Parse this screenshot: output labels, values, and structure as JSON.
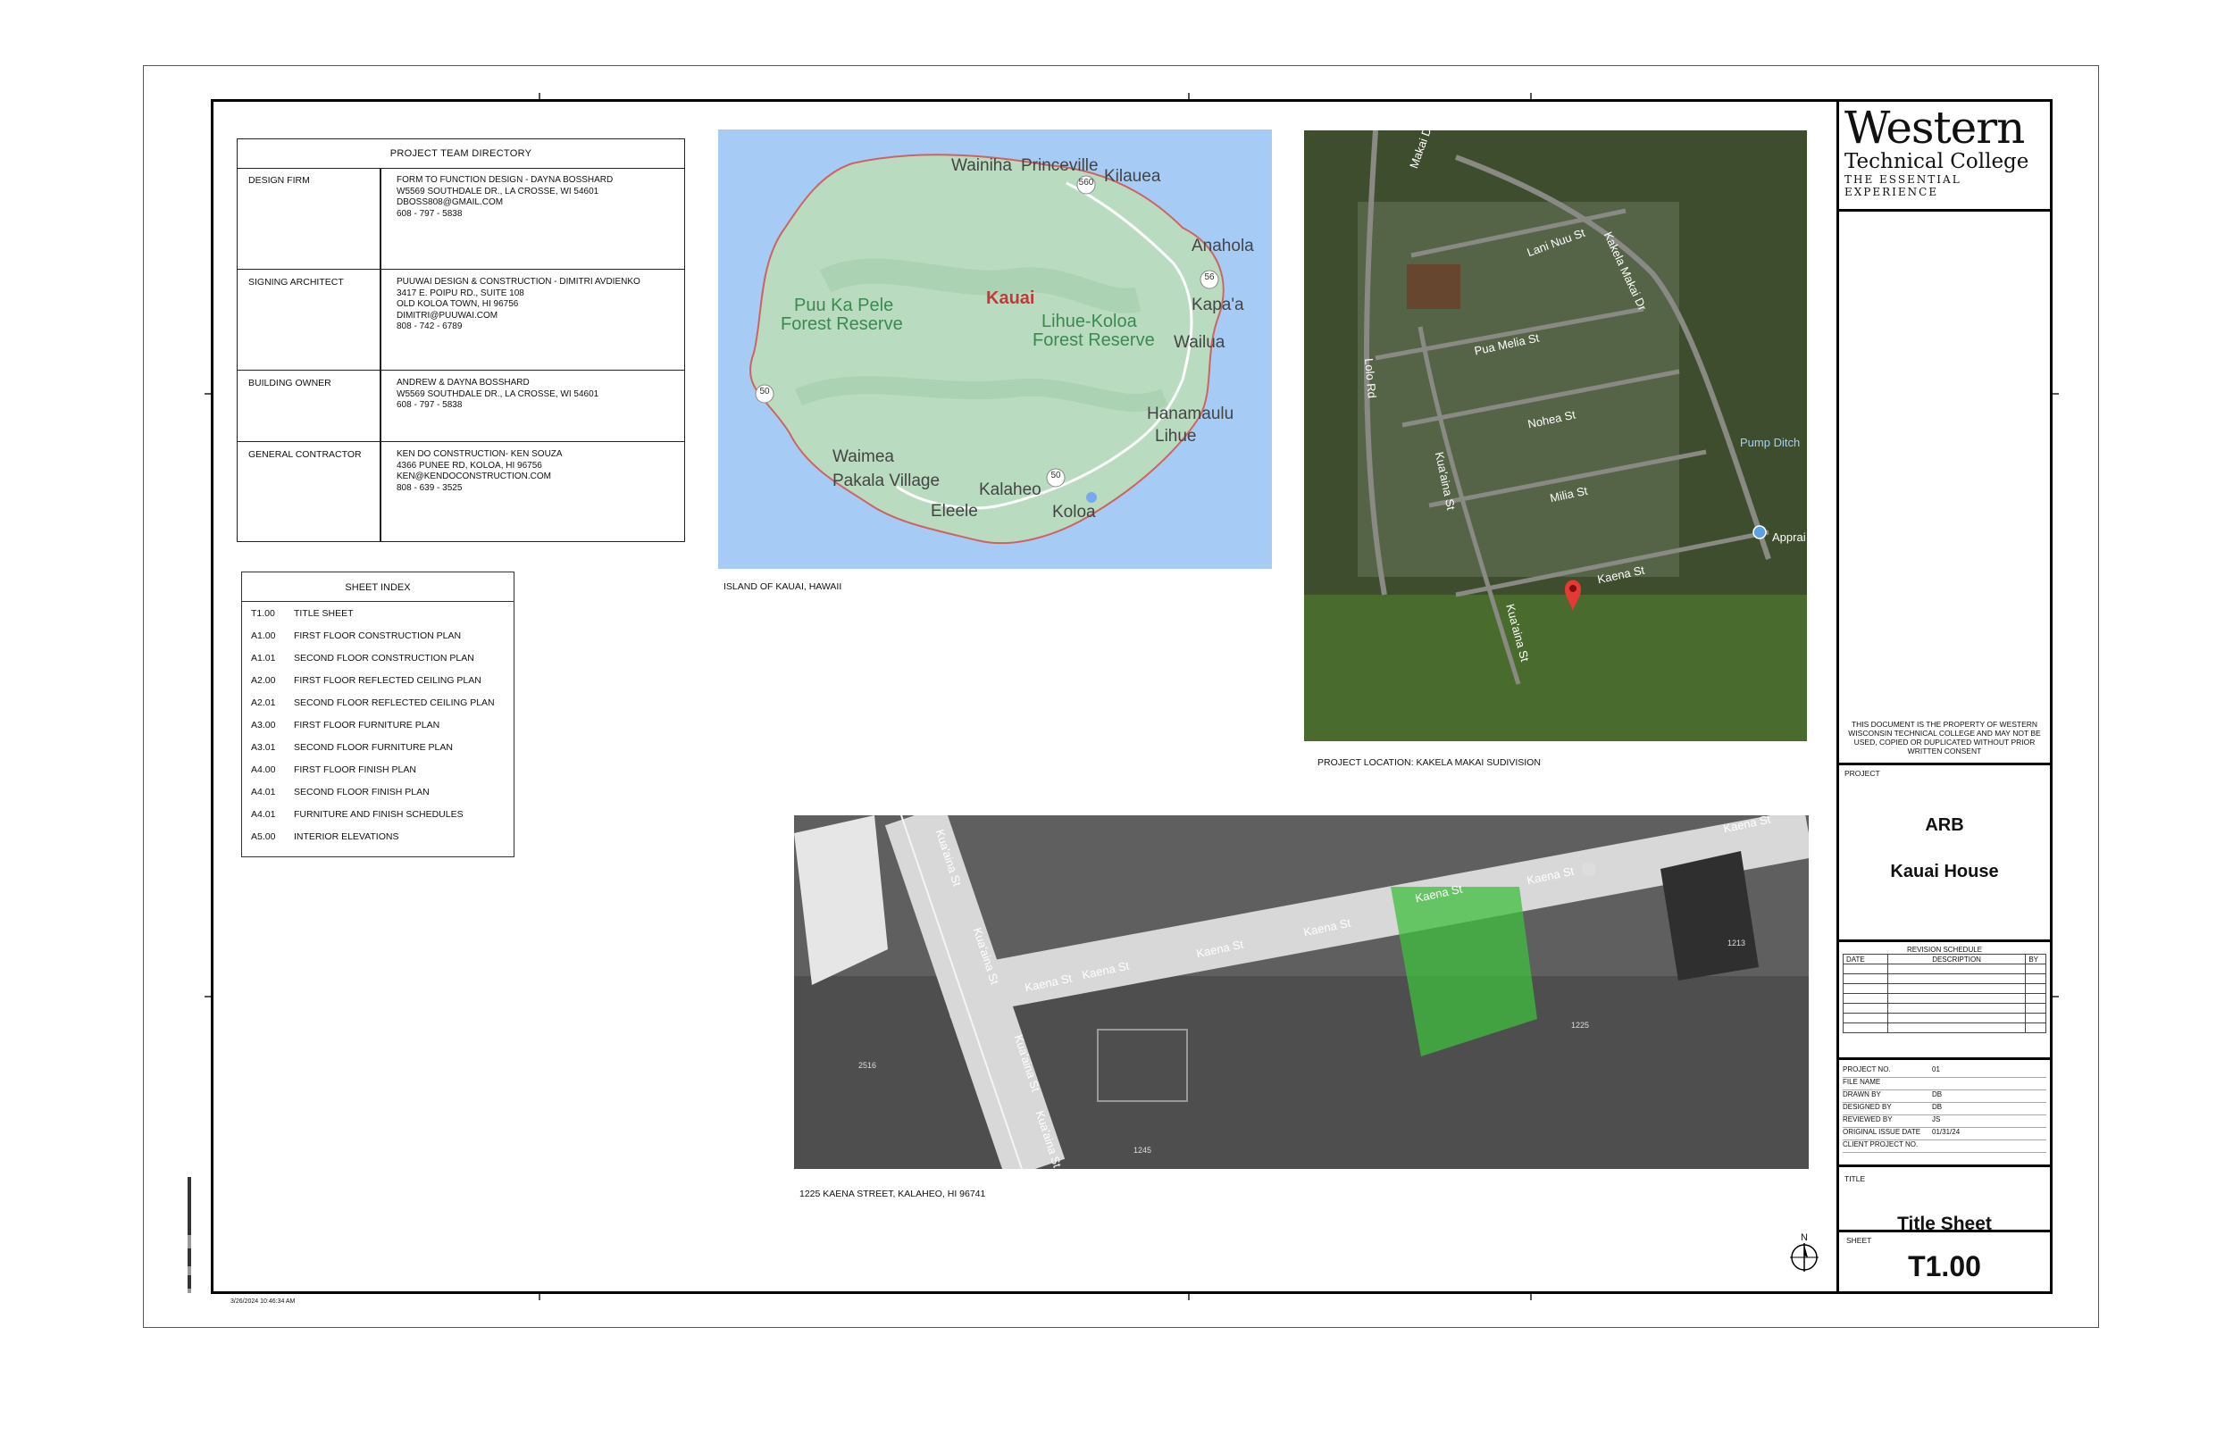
{
  "directory": {
    "title": "PROJECT TEAM DIRECTORY",
    "rows": [
      {
        "label": "DESIGN FIRM",
        "lines": [
          "FORM TO FUNCTION DESIGN - DAYNA BOSSHARD",
          "W5569 SOUTHDALE DR., LA CROSSE, WI 54601",
          "DBOSS808@GMAIL.COM",
          "608 - 797 - 5838"
        ]
      },
      {
        "label": "SIGNING ARCHITECT",
        "lines": [
          "PUUWAI DESIGN & CONSTRUCTION - DIMITRI AVDIENKO",
          "3417 E. POIPU RD., SUITE 108",
          "OLD KOLOA TOWN, HI 96756",
          "DIMITRI@PUUWAI.COM",
          "808 - 742 - 6789"
        ]
      },
      {
        "label": "BUILDING OWNER",
        "lines": [
          "ANDREW & DAYNA BOSSHARD",
          "W5569 SOUTHDALE DR., LA CROSSE, WI 54601",
          "608 - 797 - 5838"
        ]
      },
      {
        "label": "GENERAL CONTRACTOR",
        "lines": [
          "KEN DO CONSTRUCTION- KEN SOUZA",
          "4366 PUNEE RD, KOLOA, HI 96756",
          "KEN@KENDOCONSTRUCTION.COM",
          "808 - 639 - 3525"
        ]
      }
    ]
  },
  "sheet_index": {
    "title": "SHEET INDEX",
    "items": [
      {
        "num": "T1.00",
        "name": "TITLE SHEET"
      },
      {
        "num": "A1.00",
        "name": "FIRST FLOOR CONSTRUCTION PLAN"
      },
      {
        "num": "A1.01",
        "name": "SECOND FLOOR CONSTRUCTION PLAN"
      },
      {
        "num": "A2.00",
        "name": "FIRST FLOOR REFLECTED CEILING PLAN"
      },
      {
        "num": "A2.01",
        "name": "SECOND FLOOR REFLECTED CEILING PLAN"
      },
      {
        "num": "A3.00",
        "name": "FIRST FLOOR FURNITURE PLAN"
      },
      {
        "num": "A3.01",
        "name": "SECOND FLOOR FURNITURE PLAN"
      },
      {
        "num": "A4.00",
        "name": "FIRST FLOOR FINISH PLAN"
      },
      {
        "num": "A4.01",
        "name": "SECOND FLOOR FINISH PLAN"
      },
      {
        "num": "A4.01",
        "name": "FURNITURE AND FINISH SCHEDULES"
      },
      {
        "num": "A5.00",
        "name": "INTERIOR ELEVATIONS"
      }
    ]
  },
  "island_map": {
    "caption": "ISLAND OF KAUAI, HAWAII",
    "labels": [
      "Wainiha",
      "Princeville",
      "Kilauea",
      "Anahola",
      "Kapa'a",
      "Wailua",
      "Puu Ka Pele",
      "Forest Reserve",
      "Kauai",
      "Lihue-Koloa",
      "Forest Reserve",
      "Hanamaulu",
      "Lihue",
      "Waimea",
      "Pakala Village",
      "Kalaheo",
      "Eleele",
      "Koloa"
    ],
    "route_shields": [
      "560",
      "56",
      "50",
      "50"
    ]
  },
  "subdivision_map": {
    "caption": "PROJECT LOCATION: KAKELA MAKAI SUDIVISION",
    "labels": [
      "Makai Dr",
      "Lani Nuu St",
      "Kakela Makai Dr",
      "Pua Melia St",
      "Lolo Rd",
      "Nohea St",
      "Kua'aina St",
      "Pump Ditch",
      "Milia St",
      "Kaena St",
      "Kua'aina St",
      "Apprai"
    ]
  },
  "site_photo": {
    "caption": "1225 KAENA STREET, KALAHEO, HI 96741",
    "labels": [
      "Kua'aina St",
      "Kua'aina St",
      "Kua'aina St",
      "Kua'aina St",
      "Kaena St",
      "Kaena St",
      "Kaena St",
      "Kaena St",
      "Kaena St",
      "Kaena St",
      "Kaena St",
      "1213",
      "1225",
      "2516",
      "1245"
    ]
  },
  "north_arrow": "N",
  "timestamp": "3/26/2024 10:46:34 AM",
  "title_block": {
    "logo_line1": "Western",
    "logo_line2": "Technical College",
    "logo_line3": "THE ESSENTIAL EXPERIENCE",
    "disclaimer": "THIS DOCUMENT IS THE PROPERTY OF WESTERN WISCONSIN TECHNICAL COLLEGE AND MAY NOT BE USED, COPIED OR DUPLICATED WITHOUT PRIOR WRITTEN CONSENT",
    "project_label": "PROJECT",
    "project_line1": "ARB",
    "project_line2": "Kauai House",
    "revision_title": "REVISION SCHEDULE",
    "revision_cols": [
      "DATE",
      "DESCRIPTION",
      "BY"
    ],
    "info": [
      {
        "k": "PROJECT NO.",
        "v": "01"
      },
      {
        "k": "FILE NAME",
        "v": ""
      },
      {
        "k": "DRAWN BY",
        "v": "DB"
      },
      {
        "k": "DESIGNED BY",
        "v": "DB"
      },
      {
        "k": "REVIEWED BY",
        "v": "JS"
      },
      {
        "k": "ORIGINAL ISSUE DATE",
        "v": "01/31/24"
      },
      {
        "k": "CLIENT PROJECT NO.",
        "v": ""
      }
    ],
    "title_label": "TITLE",
    "title_value": "Title Sheet",
    "sheet_label": "SHEET",
    "sheet_value": "T1.00"
  },
  "colors": {
    "ocean": "#a6ccf6",
    "land": "#b9dcc0",
    "lot_highlight": "#3fbf3f",
    "pin": "#e53935"
  }
}
